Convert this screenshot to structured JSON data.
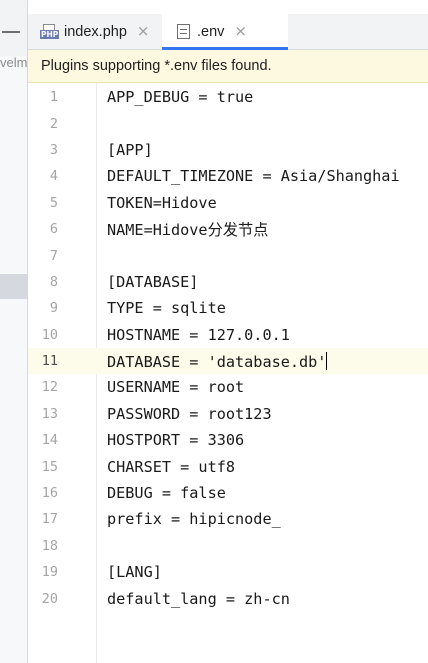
{
  "tabs": [
    {
      "label": "index.php",
      "icon": "php-file-icon",
      "close": "×"
    },
    {
      "label": ".env",
      "icon": "env-file-icon",
      "close": "×",
      "active": true
    }
  ],
  "sidebar": {
    "cut_text": "velm"
  },
  "banner": {
    "text": "Plugins supporting *.env files found."
  },
  "editor": {
    "current_line": 11,
    "lines": [
      {
        "n": "1",
        "text": "APP_DEBUG = true"
      },
      {
        "n": "2",
        "text": ""
      },
      {
        "n": "3",
        "text": "[APP]"
      },
      {
        "n": "4",
        "text": "DEFAULT_TIMEZONE = Asia/Shanghai"
      },
      {
        "n": "5",
        "text": "TOKEN=Hidove"
      },
      {
        "n": "6",
        "text": "NAME=Hidove分发节点"
      },
      {
        "n": "7",
        "text": ""
      },
      {
        "n": "8",
        "text": "[DATABASE]"
      },
      {
        "n": "9",
        "text": "TYPE = sqlite"
      },
      {
        "n": "10",
        "text": "HOSTNAME = 127.0.0.1"
      },
      {
        "n": "11",
        "text": "DATABASE = 'database.db'"
      },
      {
        "n": "12",
        "text": "USERNAME = root"
      },
      {
        "n": "13",
        "text": "PASSWORD = root123"
      },
      {
        "n": "14",
        "text": "HOSTPORT = 3306"
      },
      {
        "n": "15",
        "text": "CHARSET = utf8"
      },
      {
        "n": "16",
        "text": "DEBUG = false"
      },
      {
        "n": "17",
        "text": "prefix = hipicnode_"
      },
      {
        "n": "18",
        "text": ""
      },
      {
        "n": "19",
        "text": "[LANG]"
      },
      {
        "n": "20",
        "text": "default_lang = zh-cn"
      }
    ]
  }
}
